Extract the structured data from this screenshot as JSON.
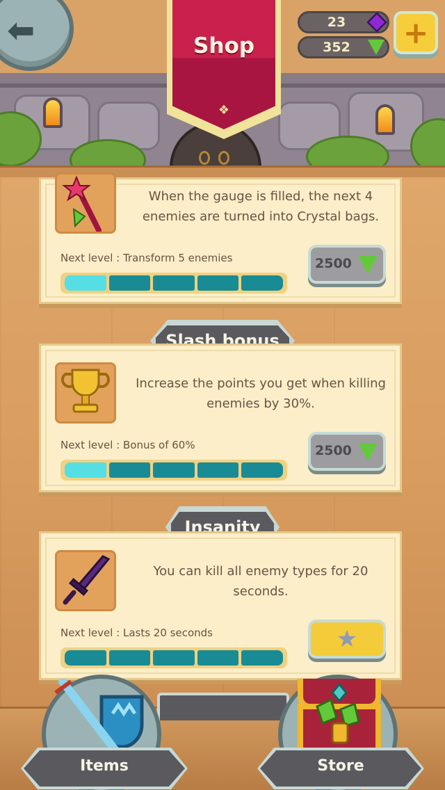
{
  "header": {
    "title": "Shop",
    "back_icon": "back-arrow-icon",
    "currency": [
      {
        "value": "23",
        "icon": "purple-gem-icon"
      },
      {
        "value": "352",
        "icon": "green-crystal-icon"
      }
    ],
    "add_icon": "plus-icon"
  },
  "upgrades": [
    {
      "title": "",
      "icon": "magic-wand-icon",
      "description": "When the gauge is filled, the next 4 enemies are turned into Crystal bags.",
      "next_level": "Next level : Transform 5 enemies",
      "level_filled": 1,
      "level_total": 5,
      "price": "2500",
      "price_icon": "green-crystal-icon"
    },
    {
      "title": "Slash bonus",
      "icon": "trophy-icon",
      "description": "Increase the points you get when killing enemies by 30%.",
      "next_level": "Next level : Bonus of 60%",
      "level_filled": 1,
      "level_total": 5,
      "price": "2500",
      "price_icon": "green-crystal-icon"
    },
    {
      "title": "Insanity",
      "icon": "dark-sword-icon",
      "description": "You can kill all enemy types for 20 seconds.",
      "next_level": "Next level : Lasts 20 seconds",
      "level_filled": 0,
      "level_total": 5,
      "price": "",
      "price_icon": "star-icon"
    }
  ],
  "nav": {
    "items_label": "Items",
    "store_label": "Store"
  },
  "colors": {
    "banner": "#c9204d",
    "gauge_filled": "#55dee4",
    "gauge_empty": "#198b94",
    "card_bg": "#fbeec8",
    "wood": "#d9a266"
  }
}
